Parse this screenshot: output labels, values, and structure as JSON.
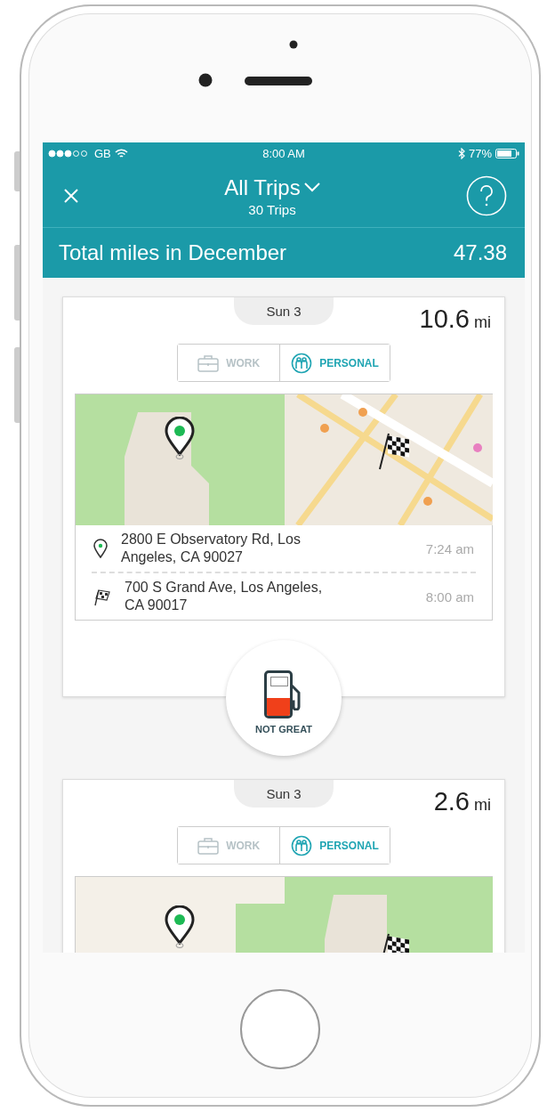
{
  "status_bar": {
    "carrier": "GB",
    "time": "8:00 AM",
    "battery": "77%"
  },
  "header": {
    "title": "All Trips",
    "subtitle": "30 Trips"
  },
  "summary": {
    "label": "Total miles in December",
    "value": "47.38"
  },
  "trips": [
    {
      "date": "Sun 3",
      "distance": "10.6",
      "unit": "mi",
      "categories": [
        {
          "label": "WORK",
          "kind": "work",
          "selected": false
        },
        {
          "label": "PERSONAL",
          "kind": "personal",
          "selected": true
        }
      ],
      "stops": [
        {
          "kind": "start",
          "address": "2800 E Observatory Rd, Los Angeles, CA 90027",
          "time": "7:24 am"
        },
        {
          "kind": "end",
          "address": "700 S Grand Ave, Los Angeles, CA 90017",
          "time": "8:00 am"
        }
      ],
      "fuel": {
        "label": "NOT GREAT",
        "level": 0.4
      }
    },
    {
      "date": "Sun 3",
      "distance": "2.6",
      "unit": "mi",
      "categories": [
        {
          "label": "WORK",
          "kind": "work",
          "selected": false
        },
        {
          "label": "PERSONAL",
          "kind": "personal",
          "selected": true
        }
      ]
    }
  ]
}
